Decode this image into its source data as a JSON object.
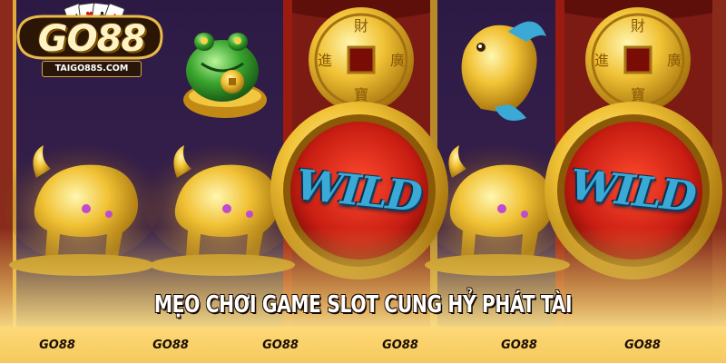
{
  "logo": {
    "text": "GO88",
    "url_text": "TAIGO88S.COM",
    "card_suits": [
      "spade-card",
      "heart-card",
      "club-card",
      "diamond-card"
    ]
  },
  "reels": {
    "symbols": [
      [
        "frog-icon",
        "ox-icon"
      ],
      [
        "coin-icon",
        "wild-icon"
      ],
      [
        "fish-icon",
        "ox-icon"
      ],
      [
        "coin-icon",
        "wild-icon"
      ]
    ],
    "wild_label": "WILD"
  },
  "title": "MẸO CHƠI GAME SLOT CUNG HỶ PHÁT TÀI",
  "footer_tags": [
    "GO88",
    "GO88",
    "GO88",
    "GO88",
    "GO88",
    "GO88"
  ],
  "colors": {
    "accent_gold": "#f5c542",
    "reel_purple": "#35204d",
    "wild_blue": "#3aa9d6",
    "footer_bar": "#f9d270",
    "coin_red": "#c81d12"
  }
}
